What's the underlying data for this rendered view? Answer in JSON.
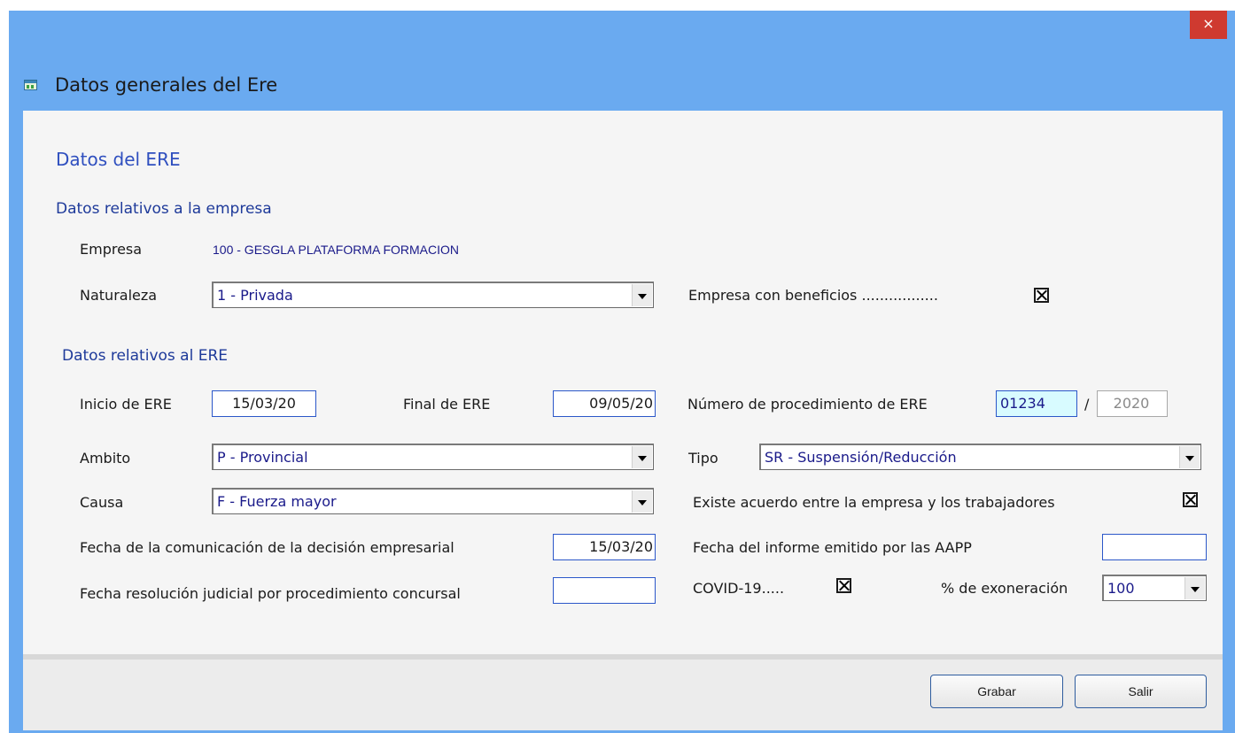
{
  "window": {
    "title": "Datos generales del Ere",
    "close_glyph": "×"
  },
  "form": {
    "heading": "Datos del ERE",
    "empresa_section": {
      "heading": "Datos relativos a la empresa",
      "empresa_label": "Empresa",
      "empresa_value": "100 - GESGLA PLATAFORMA FORMACION",
      "naturaleza_label": "Naturaleza",
      "naturaleza_value": "1 - Privada",
      "beneficios_label": "Empresa con beneficios .................",
      "beneficios_checked": true
    },
    "ere_section": {
      "heading": "Datos relativos al ERE",
      "inicio_label": "Inicio de ERE",
      "inicio_value": "15/03/20",
      "final_label": "Final de ERE",
      "final_value": "09/05/20",
      "num_proc_label": "Número de procedimiento de ERE",
      "num_proc_value": "01234",
      "separator": "/",
      "num_proc_year": "2020",
      "ambito_label": "Ambito",
      "ambito_value": "P - Provincial",
      "tipo_label": "Tipo",
      "tipo_value": "SR  - Suspensión/Reducción",
      "causa_label": "Causa",
      "causa_value": "F - Fuerza mayor",
      "acuerdo_label": "Existe acuerdo entre la empresa y los trabajadores",
      "acuerdo_checked": true,
      "fecha_comunicacion_label": "Fecha de la comunicación de la decisión empresarial",
      "fecha_comunicacion_value": "15/03/20",
      "fecha_informe_label": "Fecha del informe emitido por las AAPP",
      "fecha_informe_value": "",
      "fecha_resolucion_label": "Fecha resolución judicial por procedimiento concursal",
      "fecha_resolucion_value": "",
      "covid_label": "COVID-19.....",
      "covid_checked": true,
      "exoneracion_label": "% de exoneración",
      "exoneracion_value": "100"
    }
  },
  "buttons": {
    "grabar": "Grabar",
    "salir": "Salir"
  }
}
